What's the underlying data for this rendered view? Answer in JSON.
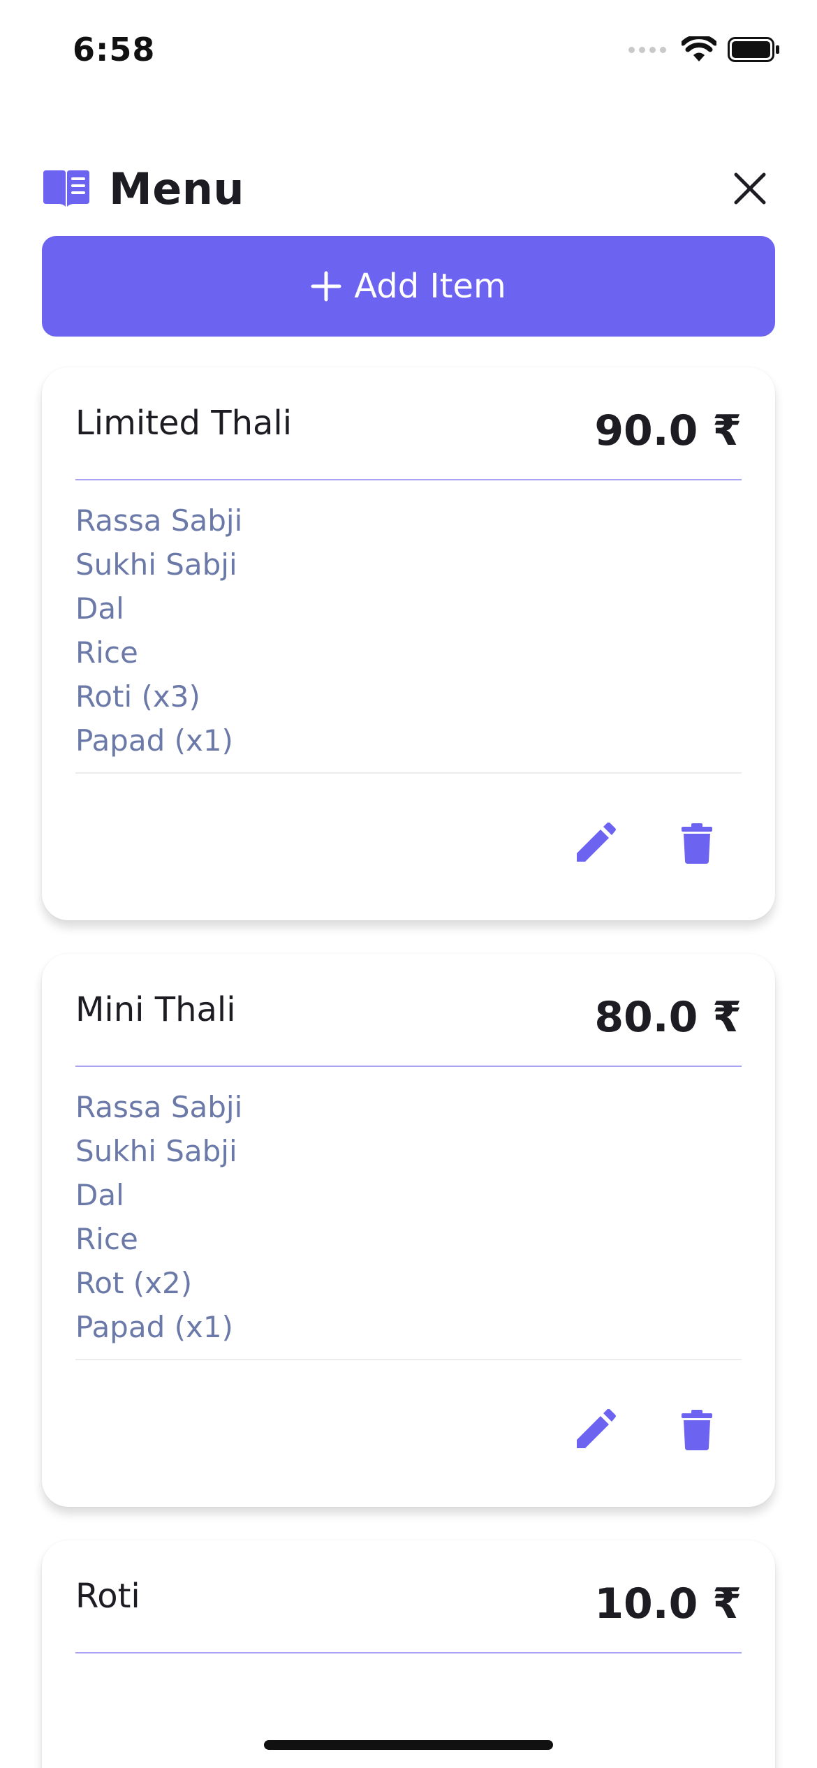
{
  "status_bar": {
    "time": "6:58"
  },
  "header": {
    "title": "Menu",
    "icon": "open-book-icon",
    "close_icon": "close-icon"
  },
  "add_button": {
    "label": "Add Item",
    "icon": "plus-icon"
  },
  "colors": {
    "accent": "#6c63f0",
    "item_text": "#6b79a8",
    "divider_accent": "#a9a4f2"
  },
  "menu_items": [
    {
      "name": "Limited Thali",
      "price": "90.0 ₹",
      "items": [
        "Rassa Sabji",
        "Sukhi Sabji",
        "Dal",
        "Rice",
        "Roti (x3)",
        "Papad (x1)"
      ]
    },
    {
      "name": "Mini Thali",
      "price": "80.0 ₹",
      "items": [
        "Rassa Sabji",
        "Sukhi Sabji",
        "Dal",
        "Rice",
        "Rot (x2)",
        "Papad (x1)"
      ]
    },
    {
      "name": "Roti",
      "price": "10.0 ₹",
      "items": []
    }
  ]
}
